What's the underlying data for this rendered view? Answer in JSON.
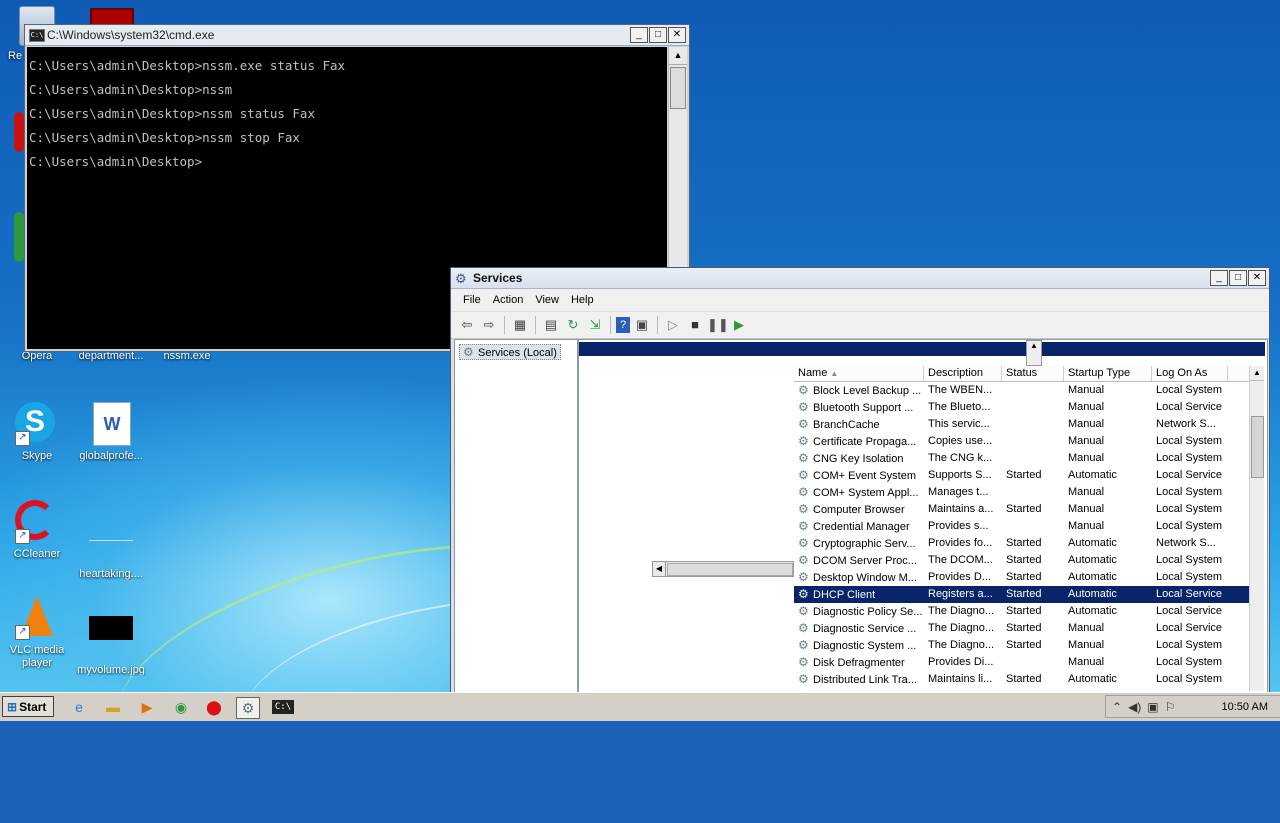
{
  "desktop": {
    "icons": [
      {
        "label": "Re"
      },
      {
        "label": "Opera"
      },
      {
        "label": "department..."
      },
      {
        "label": "nssm.exe"
      },
      {
        "label": "Skype"
      },
      {
        "label": "globalprofe..."
      },
      {
        "label": "CCleaner"
      },
      {
        "label": "heartaking...."
      },
      {
        "label": "VLC media player"
      },
      {
        "label": "myvolume.jpg"
      }
    ]
  },
  "cmd": {
    "title": "C:\\Windows\\system32\\cmd.exe",
    "lines": [
      "C:\\Users\\admin\\Desktop>nssm.exe status Fax",
      "C:\\Users\\admin\\Desktop>nssm",
      "C:\\Users\\admin\\Desktop>nssm status Fax",
      "C:\\Users\\admin\\Desktop>nssm stop Fax",
      "C:\\Users\\admin\\Desktop>"
    ]
  },
  "services": {
    "title": "Services",
    "menu": [
      "File",
      "Action",
      "View",
      "Help"
    ],
    "tree_item": "Services (Local)",
    "columns": [
      "Name",
      "Description",
      "Status",
      "Startup Type",
      "Log On As"
    ],
    "rows": [
      [
        "Block Level Backup ...",
        "The WBEN...",
        "",
        "Manual",
        "Local System"
      ],
      [
        "Bluetooth Support ...",
        "The Blueto...",
        "",
        "Manual",
        "Local Service"
      ],
      [
        "BranchCache",
        "This servic...",
        "",
        "Manual",
        "Network S..."
      ],
      [
        "Certificate Propaga...",
        "Copies use...",
        "",
        "Manual",
        "Local System"
      ],
      [
        "CNG Key Isolation",
        "The CNG k...",
        "",
        "Manual",
        "Local System"
      ],
      [
        "COM+ Event System",
        "Supports S...",
        "Started",
        "Automatic",
        "Local Service"
      ],
      [
        "COM+ System Appl...",
        "Manages t...",
        "",
        "Manual",
        "Local System"
      ],
      [
        "Computer Browser",
        "Maintains a...",
        "Started",
        "Manual",
        "Local System"
      ],
      [
        "Credential Manager",
        "Provides s...",
        "",
        "Manual",
        "Local System"
      ],
      [
        "Cryptographic Serv...",
        "Provides fo...",
        "Started",
        "Automatic",
        "Network S..."
      ],
      [
        "DCOM Server Proc...",
        "The DCOM...",
        "Started",
        "Automatic",
        "Local System"
      ],
      [
        "Desktop Window M...",
        "Provides D...",
        "Started",
        "Automatic",
        "Local System"
      ],
      [
        "DHCP Client",
        "Registers a...",
        "Started",
        "Automatic",
        "Local Service"
      ],
      [
        "Diagnostic Policy Se...",
        "The Diagno...",
        "Started",
        "Automatic",
        "Local Service"
      ],
      [
        "Diagnostic Service ...",
        "The Diagno...",
        "Started",
        "Manual",
        "Local Service"
      ],
      [
        "Diagnostic System ...",
        "The Diagno...",
        "Started",
        "Manual",
        "Local System"
      ],
      [
        "Disk Defragmenter",
        "Provides Di...",
        "",
        "Manual",
        "Local System"
      ],
      [
        "Distributed Link Tra...",
        "Maintains li...",
        "Started",
        "Automatic",
        "Local System"
      ]
    ],
    "selected_row": 12
  },
  "taskbar": {
    "start_label": "Start",
    "clock": "10:50 AM"
  },
  "colors": {
    "selection": "#0a246a",
    "desktop": "#1670c6"
  }
}
